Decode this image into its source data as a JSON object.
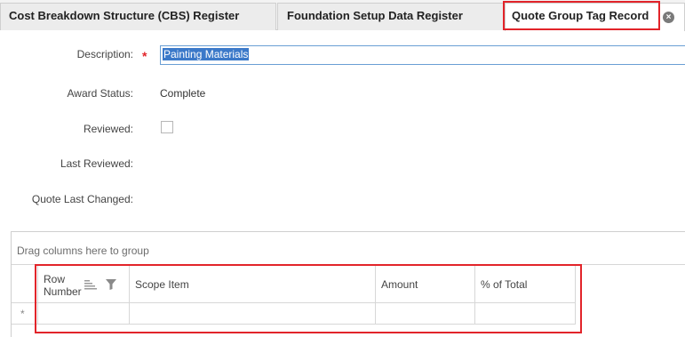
{
  "tabs": [
    {
      "label": "Cost Breakdown Structure (CBS) Register"
    },
    {
      "label": "Foundation Setup Data Register"
    },
    {
      "label": "Quote Group Tag Record",
      "active": true
    }
  ],
  "form": {
    "description_label": "Description:",
    "description_value": "Painting Materials",
    "required_marker": "*",
    "award_status_label": "Award Status:",
    "award_status_value": "Complete",
    "reviewed_label": "Reviewed:",
    "reviewed_checked": false,
    "last_reviewed_label": "Last Reviewed:",
    "quote_last_changed_label": "Quote Last Changed:"
  },
  "grid": {
    "group_panel_text": "Drag columns here to group",
    "columns": {
      "row_number_line1": "Row",
      "row_number_line2": "Number",
      "scope_item": "Scope Item",
      "amount": "Amount",
      "pct_total": "% of Total"
    },
    "new_row_marker": "*"
  },
  "icons": {
    "tab_close": "close-circle-icon",
    "sort": "sort-icon",
    "filter": "filter-icon"
  },
  "colors": {
    "highlight": "#e2242a",
    "selection": "#3b79c9",
    "required": "#e2242a"
  }
}
